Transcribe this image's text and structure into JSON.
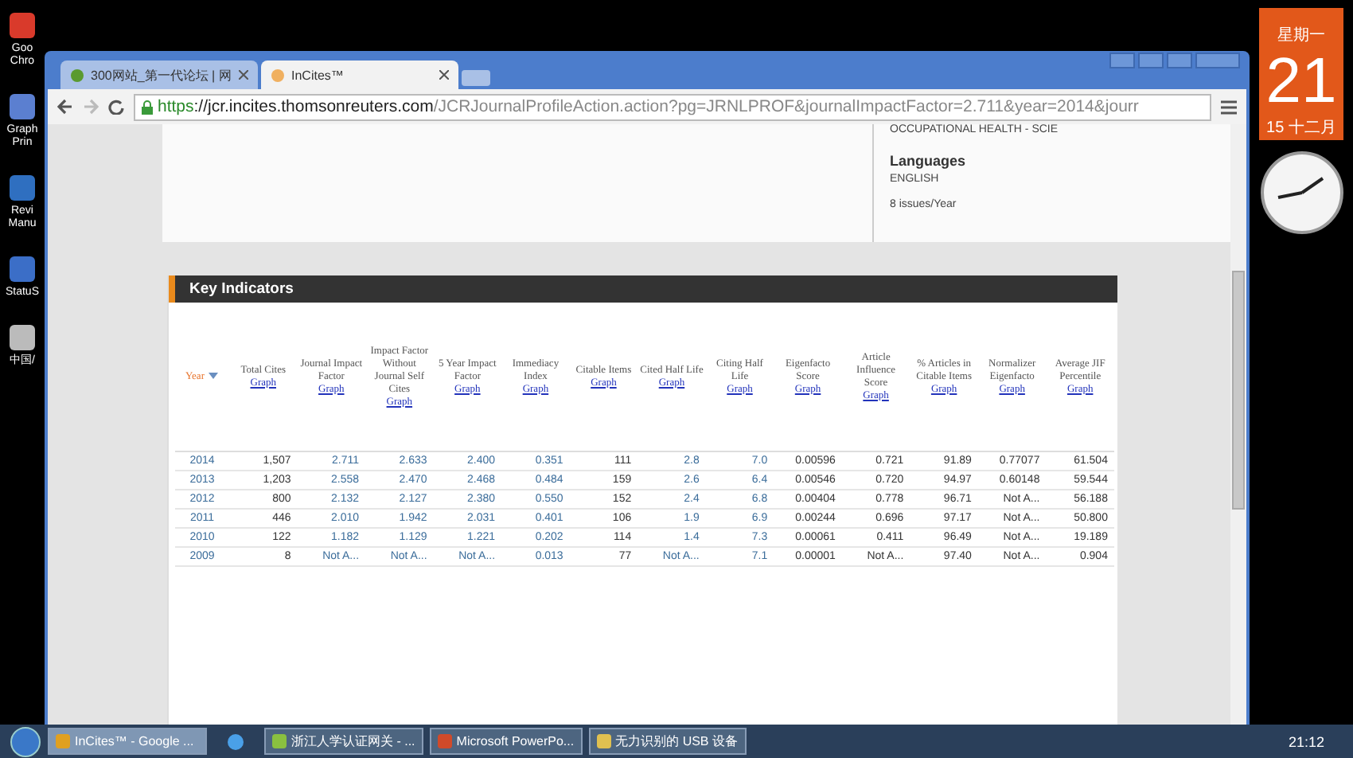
{
  "desktop_icons": [
    {
      "label": "Goo Chro"
    },
    {
      "label": "Graph Prin"
    },
    {
      "label": "Revi Manu"
    },
    {
      "label": "StatuS"
    },
    {
      "label": "中国/"
    }
  ],
  "browser": {
    "tabs": [
      {
        "label": "300网站_第一代论坛 | 网",
        "selected": false
      },
      {
        "label": "InCites™",
        "selected": true
      }
    ],
    "url_scheme": "https",
    "url_host": "://jcr.incites.thomsonreuters.com",
    "url_path": "/JCRJournalProfileAction.action?pg=JRNLPROF&journalImpactFactor=2.711&year=2014&jourr"
  },
  "profile": {
    "category": "OCCUPATIONAL HEALTH - SCIE",
    "languages_label": "Languages",
    "language": "ENGLISH",
    "issues": "8 issues/Year"
  },
  "key_indicators": {
    "title": "Key Indicators",
    "columns": [
      {
        "label": "Year",
        "sorted": true,
        "link": true
      },
      {
        "label": "Total Cites",
        "graph": "Graph",
        "link": false
      },
      {
        "label": "Journal Impact Factor",
        "graph": "Graph",
        "link": true
      },
      {
        "label": "Impact Factor Without Journal Self Cites",
        "graph": "Graph",
        "link": true
      },
      {
        "label": "5 Year Impact Factor",
        "graph": "Graph",
        "link": true
      },
      {
        "label": "Immediacy Index",
        "graph": "Graph",
        "link": true
      },
      {
        "label": "Citable Items",
        "graph": "Graph",
        "link": false
      },
      {
        "label": "Cited Half Life",
        "graph": "Graph",
        "link": true
      },
      {
        "label": "Citing Half Life",
        "graph": "Graph",
        "link": true
      },
      {
        "label": "Eigenfacto Score",
        "graph": "Graph",
        "link": false
      },
      {
        "label": "Article Influence Score",
        "graph": "Graph",
        "link": false
      },
      {
        "label": "% Articles in Citable Items",
        "graph": "Graph",
        "link": false
      },
      {
        "label": "Normalizer Eigenfacto",
        "graph": "Graph",
        "link": false
      },
      {
        "label": "Average JIF Percentile",
        "graph": "Graph",
        "link": false
      }
    ],
    "rows": [
      [
        "2014",
        "1,507",
        "2.711",
        "2.633",
        "2.400",
        "0.351",
        "111",
        "2.8",
        "7.0",
        "0.00596",
        "0.721",
        "91.89",
        "0.77077",
        "61.504"
      ],
      [
        "2013",
        "1,203",
        "2.558",
        "2.470",
        "2.468",
        "0.484",
        "159",
        "2.6",
        "6.4",
        "0.00546",
        "0.720",
        "94.97",
        "0.60148",
        "59.544"
      ],
      [
        "2012",
        "800",
        "2.132",
        "2.127",
        "2.380",
        "0.550",
        "152",
        "2.4",
        "6.8",
        "0.00404",
        "0.778",
        "96.71",
        "Not A...",
        "56.188"
      ],
      [
        "2011",
        "446",
        "2.010",
        "1.942",
        "2.031",
        "0.401",
        "106",
        "1.9",
        "6.9",
        "0.00244",
        "0.696",
        "97.17",
        "Not A...",
        "50.800"
      ],
      [
        "2010",
        "122",
        "1.182",
        "1.129",
        "1.221",
        "0.202",
        "114",
        "1.4",
        "7.3",
        "0.00061",
        "0.411",
        "96.49",
        "Not A...",
        "19.189"
      ],
      [
        "2009",
        "8",
        "Not A...",
        "Not A...",
        "Not A...",
        "0.013",
        "77",
        "Not A...",
        "7.1",
        "0.00001",
        "Not A...",
        "97.40",
        "Not A...",
        "0.904"
      ]
    ]
  },
  "calendar": {
    "weekday": "星期一",
    "day": "21",
    "month": "15 十二月"
  },
  "taskbar": {
    "items": [
      {
        "label": "InCites™ - Google ...",
        "selected": true
      },
      {
        "label": "浙江人学认证网关 - ...",
        "selected": false
      },
      {
        "label": "Microsoft PowerPo...",
        "selected": false
      },
      {
        "label": "无力识别的 USB 设备",
        "selected": false
      }
    ],
    "time": "21:12"
  }
}
